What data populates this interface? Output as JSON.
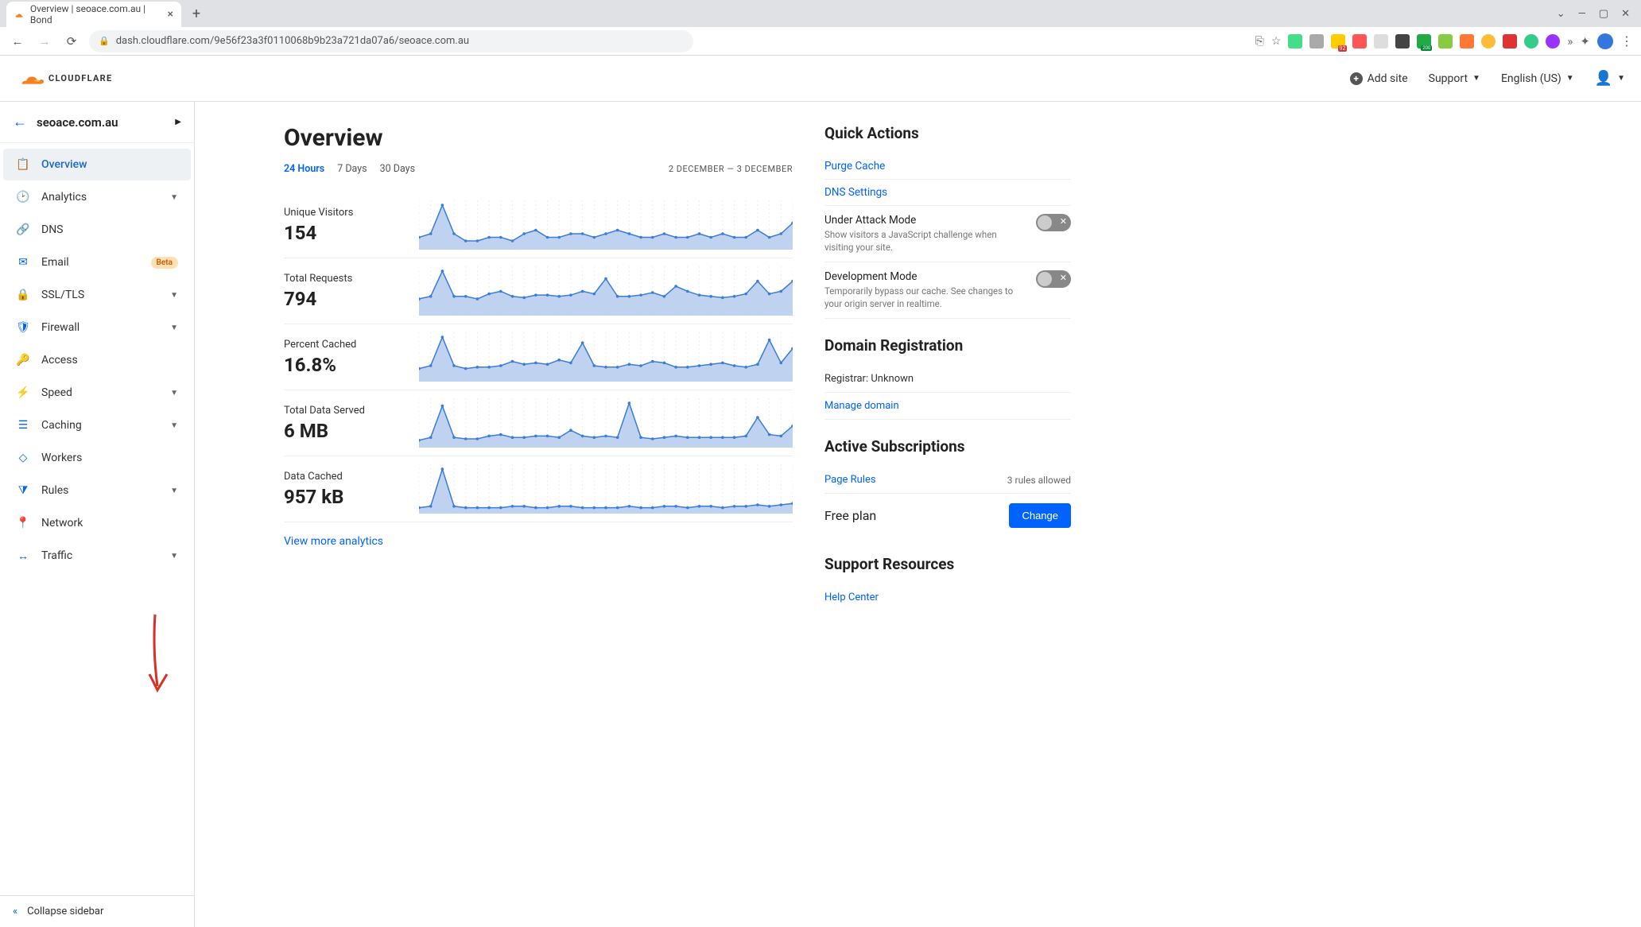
{
  "browser": {
    "tab_title": "Overview | seoace.com.au | Bond",
    "url": "dash.cloudflare.com/9e56f23a3f0110068b9b23a721da07a6/seoace.com.au"
  },
  "header": {
    "add_site": "Add site",
    "support": "Support",
    "language": "English (US)"
  },
  "sidebar": {
    "site": "seoace.com.au",
    "items": [
      {
        "label": "Overview",
        "icon": "clipboard",
        "active": true,
        "expandable": false
      },
      {
        "label": "Analytics",
        "icon": "clock",
        "expandable": true
      },
      {
        "label": "DNS",
        "icon": "sitemap",
        "expandable": false
      },
      {
        "label": "Email",
        "icon": "mail",
        "expandable": false,
        "badge": "Beta"
      },
      {
        "label": "SSL/TLS",
        "icon": "lock",
        "expandable": true
      },
      {
        "label": "Firewall",
        "icon": "shield",
        "expandable": true
      },
      {
        "label": "Access",
        "icon": "key",
        "expandable": false
      },
      {
        "label": "Speed",
        "icon": "bolt",
        "expandable": true
      },
      {
        "label": "Caching",
        "icon": "layers",
        "expandable": true
      },
      {
        "label": "Workers",
        "icon": "hex",
        "expandable": false
      },
      {
        "label": "Rules",
        "icon": "filter",
        "expandable": true
      },
      {
        "label": "Network",
        "icon": "pin",
        "expandable": false
      },
      {
        "label": "Traffic",
        "icon": "share",
        "expandable": true
      }
    ],
    "collapse": "Collapse sidebar"
  },
  "main": {
    "title": "Overview",
    "ranges": [
      "24 Hours",
      "7 Days",
      "30 Days"
    ],
    "active_range": 0,
    "date_range": "2 DECEMBER — 3 DECEMBER",
    "view_more": "View more analytics"
  },
  "chart_data": [
    {
      "type": "area",
      "label": "Unique Visitors",
      "value": "154",
      "series": [
        3,
        4,
        12,
        4,
        2,
        2,
        3,
        3,
        2,
        4,
        5,
        3,
        3,
        4,
        4,
        3,
        4,
        5,
        4,
        3,
        3,
        4,
        3,
        3,
        4,
        3,
        4,
        3,
        3,
        5,
        3,
        4,
        7
      ]
    },
    {
      "type": "area",
      "label": "Total Requests",
      "value": "794",
      "series": [
        12,
        14,
        34,
        14,
        14,
        12,
        16,
        18,
        14,
        13,
        15,
        15,
        14,
        15,
        18,
        16,
        28,
        14,
        14,
        15,
        17,
        14,
        22,
        18,
        15,
        14,
        13,
        14,
        16,
        26,
        16,
        18,
        26
      ]
    },
    {
      "type": "area",
      "label": "Percent Cached",
      "value": "16.8%",
      "series": [
        8,
        10,
        30,
        10,
        8,
        9,
        9,
        10,
        13,
        11,
        12,
        11,
        14,
        12,
        26,
        10,
        9,
        9,
        11,
        10,
        13,
        12,
        9,
        9,
        10,
        11,
        12,
        10,
        9,
        11,
        28,
        12,
        22
      ]
    },
    {
      "type": "area",
      "label": "Total Data Served",
      "value": "6 MB",
      "series": [
        4,
        6,
        28,
        6,
        5,
        5,
        7,
        8,
        6,
        6,
        7,
        7,
        6,
        11,
        7,
        6,
        7,
        6,
        30,
        6,
        5,
        6,
        7,
        6,
        6,
        6,
        6,
        6,
        7,
        20,
        8,
        7,
        14
      ]
    },
    {
      "type": "area",
      "label": "Data Cached",
      "value": "957 kB",
      "series": [
        3,
        4,
        30,
        4,
        3,
        3,
        3,
        3,
        4,
        4,
        3,
        3,
        4,
        4,
        3,
        3,
        3,
        3,
        4,
        3,
        3,
        4,
        4,
        3,
        4,
        4,
        3,
        4,
        4,
        5,
        4,
        5,
        6
      ]
    }
  ],
  "quick_actions": {
    "title": "Quick Actions",
    "links": [
      "Purge Cache",
      "DNS Settings"
    ],
    "modes": [
      {
        "title": "Under Attack Mode",
        "desc": "Show visitors a JavaScript challenge when visiting your site.",
        "on": false
      },
      {
        "title": "Development Mode",
        "desc": "Temporarily bypass our cache. See changes to your origin server in realtime.",
        "on": false
      }
    ]
  },
  "domain_reg": {
    "title": "Domain Registration",
    "registrar": "Registrar: Unknown",
    "manage": "Manage domain"
  },
  "subscriptions": {
    "title": "Active Subscriptions",
    "page_rules": "Page Rules",
    "page_rules_note": "3 rules allowed",
    "plan": "Free plan",
    "change": "Change"
  },
  "support_resources": {
    "title": "Support Resources",
    "help_center": "Help Center"
  }
}
